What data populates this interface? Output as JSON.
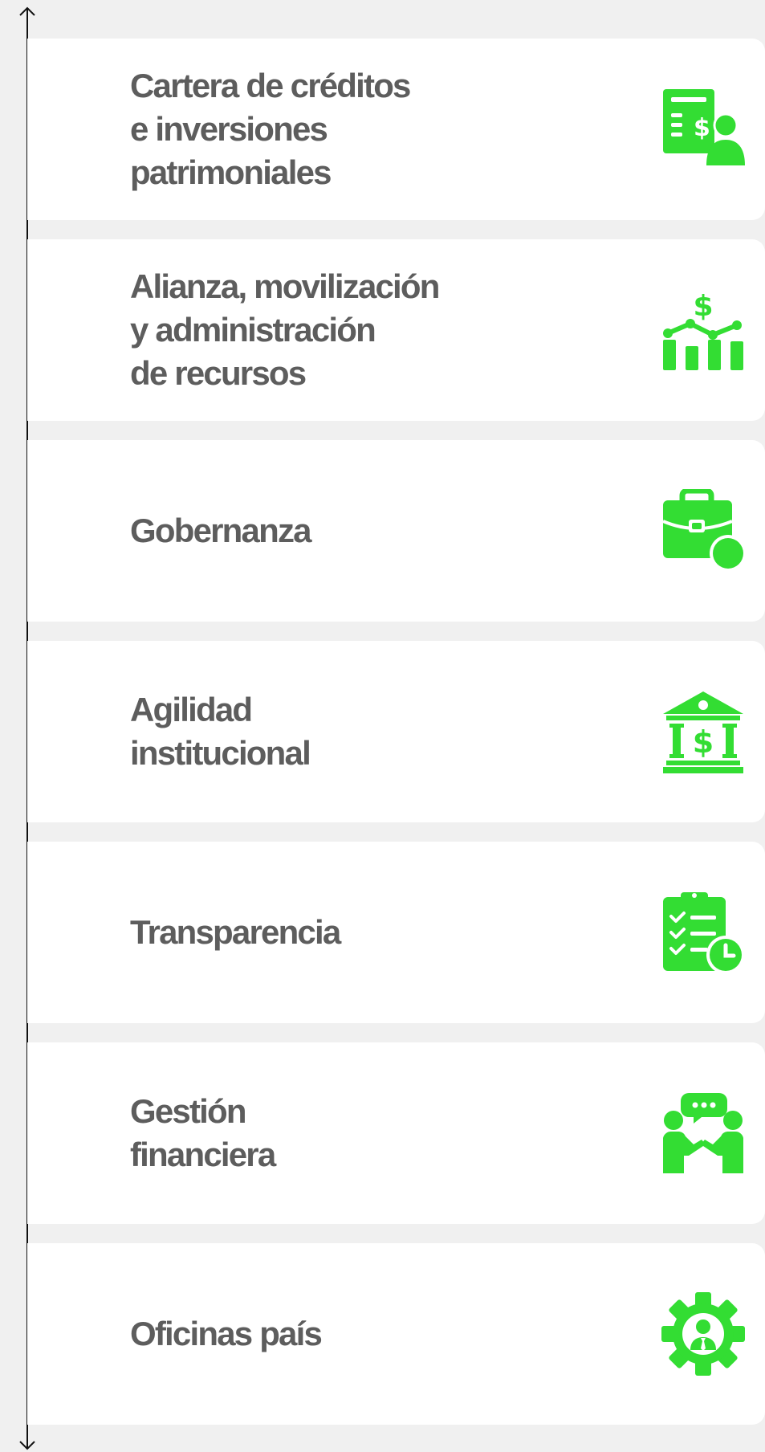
{
  "accent_color": "#33dd33",
  "text_color": "#5d5d5d",
  "items": [
    {
      "label": "Cartera de créditos\ne inversiones\npatrimoniales",
      "icon": "credit-portfolio-icon"
    },
    {
      "label": "Alianza, movilización\ny administración\nde recursos",
      "icon": "growth-chart-dollar-icon"
    },
    {
      "label": "Gobernanza",
      "icon": "briefcase-icon"
    },
    {
      "label": "Agilidad\ninstitucional",
      "icon": "bank-building-icon"
    },
    {
      "label": "Transparencia",
      "icon": "clipboard-checklist-clock-icon"
    },
    {
      "label": "Gestión\nfinanciera",
      "icon": "handshake-conversation-icon"
    },
    {
      "label": "Oficinas país",
      "icon": "gear-person-icon"
    }
  ]
}
